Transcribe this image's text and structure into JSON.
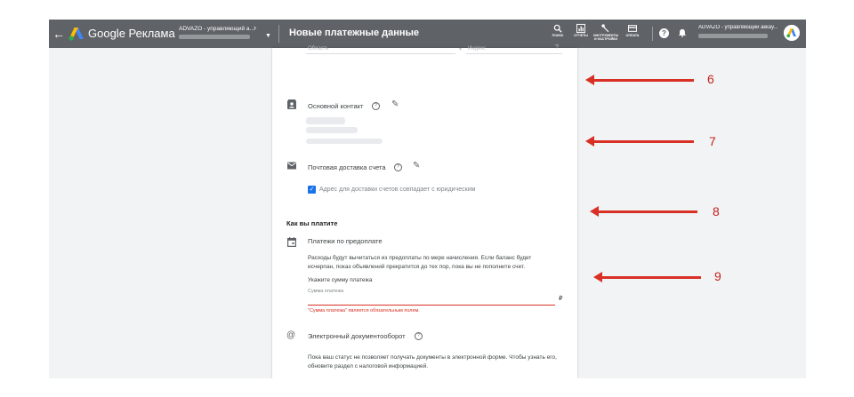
{
  "topbar": {
    "back_icon": "arrow-left-icon",
    "brand": "Google Реклама",
    "account_name": "ADVAZO - управляющий а...",
    "page_title": "Новые платежные данные",
    "tools": [
      {
        "icon": "search-icon",
        "label": "ПОИСК"
      },
      {
        "icon": "reports-icon",
        "label": "ОТЧЕТЫ"
      },
      {
        "icon": "wrench-icon",
        "label": "ИНСТРУМЕНТЫ И НАСТРОЙКИ"
      },
      {
        "icon": "credit-card-icon",
        "label": "ОПЛАТА"
      }
    ],
    "user_name": "ADVAZO - управляющий аккау..."
  },
  "form": {
    "top_field_left": "Область",
    "top_field_right": "Индекс",
    "primary_contact_label": "Основной контакт",
    "mail_delivery_label": "Почтовая доставка счета",
    "same_address_checkbox": "Адрес для доставки счетов совпадает с юридическим",
    "how_you_pay_heading": "Как вы платите",
    "prepay_label": "Платежи по предоплате",
    "prepay_description": "Расходы будут вычитаться из предоплаты по мере начисления. Если баланс будет исчерпан, показ объявлений прекратится до тех пор, пока вы не пополните счет.",
    "amount_label": "Укажите сумму платежа",
    "amount_placeholder": "Сумма платежа",
    "currency_symbol": "₽",
    "amount_error": "\"Сумма платежа\" является обязательным полем.",
    "edoc_label": "Электронный документооборот",
    "edoc_description": "Пока ваш статус не позволяет получать документы в электронной форме. Чтобы узнать его, обновите раздел с налоговой информацией."
  },
  "annotations": [
    "6",
    "7",
    "8",
    "9"
  ],
  "colors": {
    "topbar": "#5f6368",
    "accent": "#1a73e8",
    "error": "#d93025",
    "annotation_red": "#d93025"
  }
}
